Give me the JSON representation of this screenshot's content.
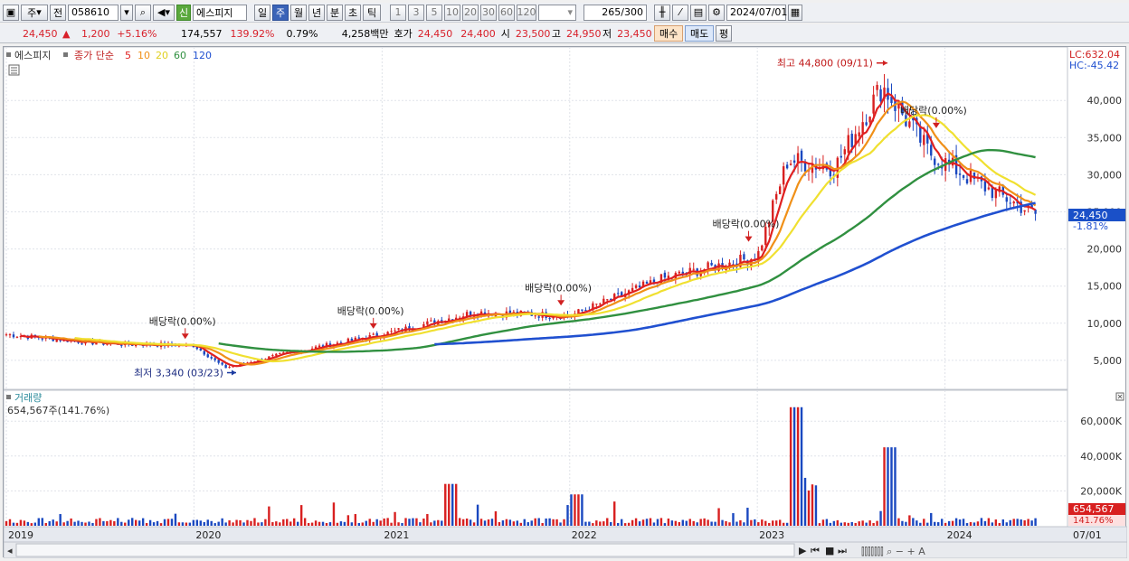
{
  "toolbar": {
    "market_label": "주",
    "prev_label": "전",
    "code": "058610",
    "new_badge": "신",
    "name": "에스피지",
    "period_tabs": [
      "일",
      "주",
      "월",
      "년",
      "분",
      "초",
      "틱"
    ],
    "active_period": "주",
    "interval_buttons": [
      "1",
      "3",
      "5",
      "10",
      "20",
      "30",
      "60",
      "120"
    ],
    "count_value": "265",
    "count_max": "/300",
    "date": "2024/07/01"
  },
  "quote": {
    "price": "24,450",
    "change": "1,200",
    "change_pct": "+5.16%",
    "volume": "174,557",
    "volume_ratio": "139.92%",
    "turnover": "0.79%",
    "amount": "4,258백만",
    "hoga_label": "호가",
    "ask": "24,450",
    "bid": "24,400",
    "open_label": "시",
    "open": "23,500",
    "high_label": "고",
    "high": "24,950",
    "low_label": "저",
    "low": "23,450",
    "buy_button": "매수",
    "sell_button": "매도",
    "eval_button": "평"
  },
  "legend": {
    "stock": "에스피지",
    "ma_label": "종가 단순",
    "ma_periods": [
      "5",
      "10",
      "20",
      "60",
      "120"
    ],
    "ma_colors": [
      "#e02020",
      "#f09018",
      "#f0e030",
      "#309040",
      "#2050d0"
    ]
  },
  "axis_corner": {
    "lc": "LC:632.04",
    "hc": "HC:-45.42"
  },
  "price_panel": {
    "y_ticks": [
      "40,000",
      "35,000",
      "30,000",
      "25,000",
      "20,000",
      "15,000",
      "10,000",
      "5,000"
    ],
    "current_price": "24,450",
    "current_pct": "-1.81%",
    "high_annotation": "최고 44,800 (09/11)",
    "low_annotation": "최저 3,340 (03/23)",
    "dividend_label": "배당락(0.00%)"
  },
  "volume_panel": {
    "title": "거래량",
    "value": "654,567주(141.76%)",
    "y_ticks": [
      "60,000K",
      "40,000K",
      "20,000K"
    ],
    "current_vol": "654,567",
    "current_pct": "141.76%"
  },
  "x_axis": {
    "labels": [
      "2019",
      "2020",
      "2021",
      "2022",
      "2023",
      "2024",
      "07/01"
    ]
  },
  "chart_data": {
    "type": "line",
    "title": "에스피지",
    "x": [
      "2019-01",
      "2019-07",
      "2020-01",
      "2020-03",
      "2020-07",
      "2021-01",
      "2021-07",
      "2022-01",
      "2022-07",
      "2023-01",
      "2023-03",
      "2023-06",
      "2023-09",
      "2023-12",
      "2024-03",
      "2024-07"
    ],
    "series": [
      {
        "name": "5",
        "values": [
          8500,
          7300,
          7000,
          4000,
          6000,
          8500,
          11500,
          11000,
          16000,
          19000,
          32000,
          31000,
          42000,
          33000,
          29000,
          24450
        ]
      },
      {
        "name": "120",
        "values": [
          null,
          null,
          null,
          null,
          null,
          7000,
          7500,
          8000,
          9500,
          11000,
          12500,
          15000,
          17500,
          20500,
          23000,
          25000
        ]
      }
    ],
    "ylim": [
      0,
      45000
    ],
    "yticks": [
      5000,
      10000,
      15000,
      20000,
      25000,
      30000,
      35000,
      40000
    ],
    "high_point": {
      "label": "최고",
      "value": 44800,
      "date": "09/11"
    },
    "low_point": {
      "label": "최저",
      "value": 3340,
      "date": "03/23"
    },
    "volume": {
      "ylim": [
        0,
        70000
      ],
      "unit": "K",
      "yticks": [
        20000,
        40000,
        60000
      ]
    }
  }
}
